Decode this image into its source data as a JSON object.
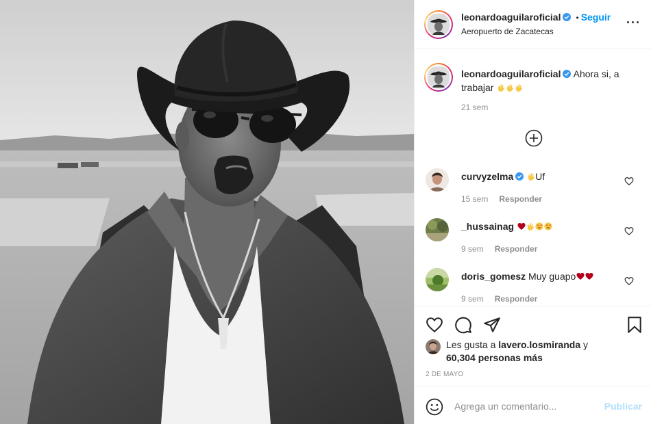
{
  "post": {
    "username": "leonardoaguilaroficial",
    "verified": true,
    "follow_label": "Seguir",
    "separator": "•",
    "location": "Aeropuerto de Zacatecas",
    "more_icon": "more-horizontal-icon",
    "photo_description_icon": "photo"
  },
  "caption": {
    "username": "leonardoaguilaroficial",
    "text": "Ahora si, a trabajar",
    "emojis": [
      "clap-icon",
      "clap-icon",
      "clap-icon"
    ],
    "time": "21 sem"
  },
  "comments": [
    {
      "username": "curvyzelma",
      "verified": true,
      "text": "Uf",
      "emojis_before": [
        "clap-icon"
      ],
      "emojis_after": [],
      "time": "15 sem",
      "reply_label": "Responder"
    },
    {
      "username": "_hussainag",
      "verified": false,
      "text": "",
      "emojis_before": [],
      "emojis_after": [
        "heart-red-icon",
        "clap-icon",
        "heart-eyes-icon",
        "heart-eyes-icon"
      ],
      "time": "9 sem",
      "reply_label": "Responder"
    },
    {
      "username": "doris_gomesz",
      "verified": false,
      "text": "Muy guapo",
      "emojis_before": [],
      "emojis_after": [
        "heart-red-icon",
        "heart-red-icon"
      ],
      "time": "9 sem",
      "reply_label": "Responder"
    }
  ],
  "likes": {
    "prefix": "Les gusta a ",
    "user": "lavero.losmiranda",
    "joiner": " y",
    "others": "60,304 personas más"
  },
  "date": "2 DE MAYO",
  "add_comment": {
    "placeholder": "Agrega un comentario...",
    "post_label": "Publicar"
  },
  "colors": {
    "accent": "#0095f6",
    "muted": "#8e8e8e",
    "post_disabled": "#b2dffc",
    "like_heart": "#ed4956"
  }
}
